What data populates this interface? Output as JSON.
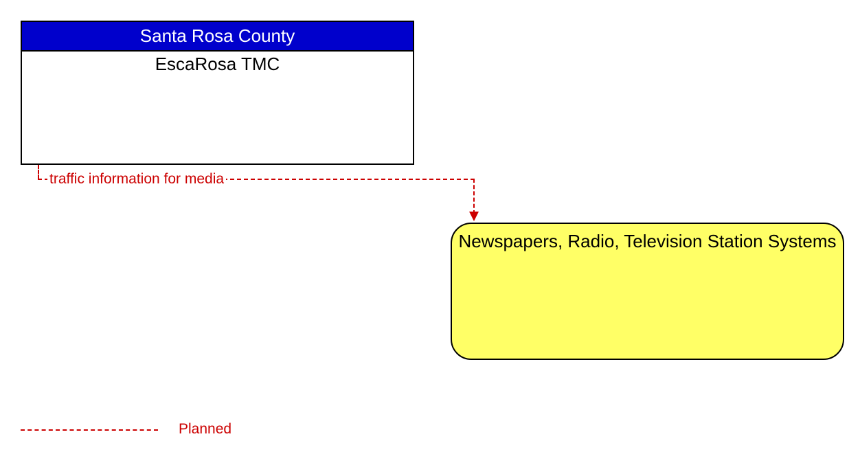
{
  "box1": {
    "header": "Santa Rosa County",
    "body": "EscaRosa TMC"
  },
  "box2": {
    "body": "Newspapers, Radio, Television Station Systems"
  },
  "flow": {
    "label": "traffic information for media"
  },
  "legend": {
    "planned": "Planned"
  }
}
